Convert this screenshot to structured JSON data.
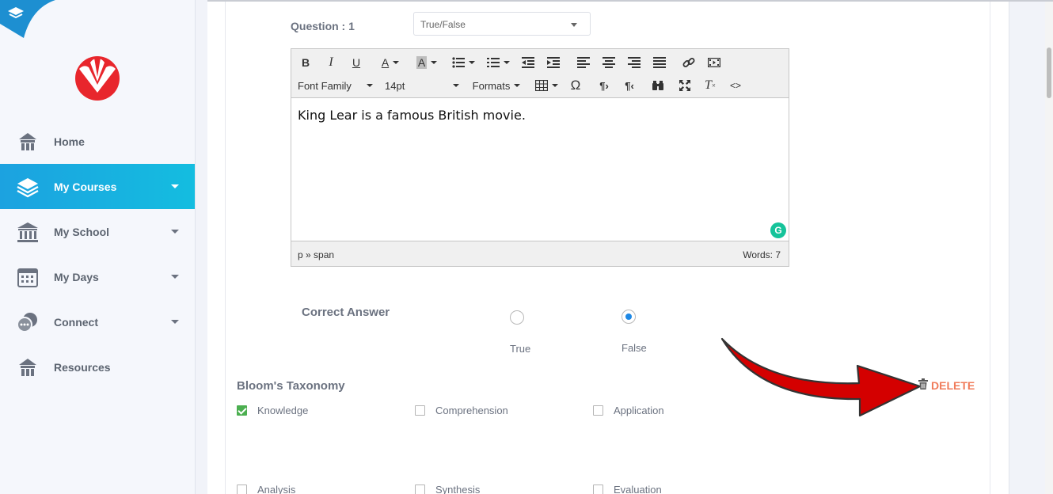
{
  "sidebar": {
    "items": [
      {
        "label": "Home",
        "icon": "home-icon",
        "active": false,
        "has_caret": false
      },
      {
        "label": "My Courses",
        "icon": "layers-icon",
        "active": true,
        "has_caret": true
      },
      {
        "label": "My School",
        "icon": "school-icon",
        "active": false,
        "has_caret": true
      },
      {
        "label": "My Days",
        "icon": "calendar-icon",
        "active": false,
        "has_caret": true
      },
      {
        "label": "Connect",
        "icon": "chat-icon",
        "active": false,
        "has_caret": true
      },
      {
        "label": "Resources",
        "icon": "resources-icon",
        "active": false,
        "has_caret": false
      }
    ],
    "active_color": "#1ca2e0",
    "logo_color": "#e8262c"
  },
  "question": {
    "label": "Question : 1",
    "type_value": "True/False"
  },
  "editor": {
    "toolbar": {
      "font_family": "Font Family",
      "font_size": "14pt",
      "formats": "Formats"
    },
    "content": "King Lear is a famous British movie.",
    "status_path": "p » span",
    "word_count": "Words: 7"
  },
  "answer": {
    "label": "Correct Answer",
    "options": [
      {
        "label": "True",
        "selected": false
      },
      {
        "label": "False",
        "selected": true
      }
    ]
  },
  "bloom": {
    "title": "Bloom's Taxonomy",
    "levels": [
      {
        "label": "Knowledge",
        "checked": true
      },
      {
        "label": "Comprehension",
        "checked": false
      },
      {
        "label": "Application",
        "checked": false
      },
      {
        "label": "Analysis",
        "checked": false
      },
      {
        "label": "Synthesis",
        "checked": false
      },
      {
        "label": "Evaluation",
        "checked": false
      }
    ]
  },
  "actions": {
    "delete_label": "DELETE",
    "delete_color": "#f07b5a"
  },
  "annotation": {
    "arrow_color": "#d40000"
  }
}
